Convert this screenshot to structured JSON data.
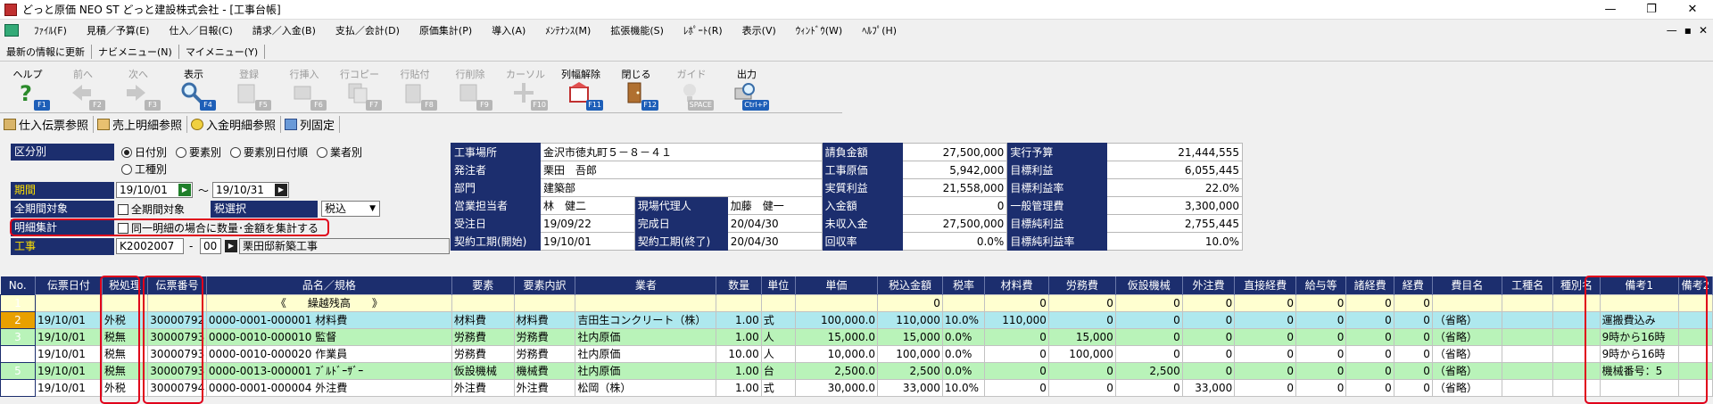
{
  "window": {
    "title": "どっと原価 NEO ST どっと建設株式会社 - [工事台帳]",
    "controls": [
      "—",
      "❐",
      "✕"
    ]
  },
  "menu": [
    "ﾌｧｲﾙ(F)",
    "見積／予算(E)",
    "仕入／日報(C)",
    "請求／入金(B)",
    "支払／会計(D)",
    "原価集計(P)",
    "導入(A)",
    "ﾒﾝﾃﾅﾝｽ(M)",
    "拡張機能(S)",
    "ﾚﾎﾟｰﾄ(R)",
    "表示(V)",
    "ｳｨﾝﾄﾞｳ(W)",
    "ﾍﾙﾌﾟ(H)"
  ],
  "mdi_controls": [
    "—",
    "▪",
    "✕"
  ],
  "bar2": [
    "最新の情報に更新",
    "ナビメニュー(N)",
    "マイメニュー(Y)"
  ],
  "toolbar": [
    {
      "label": "ヘルプ",
      "key": "F1",
      "icon": "question-icon",
      "enabled": true
    },
    {
      "label": "前へ",
      "key": "F2",
      "icon": "arrow-left-icon",
      "enabled": false
    },
    {
      "label": "次へ",
      "key": "F3",
      "icon": "arrow-right-icon",
      "enabled": false
    },
    {
      "label": "表示",
      "key": "F4",
      "icon": "magnifier-icon",
      "enabled": true
    },
    {
      "label": "登録",
      "key": "F5",
      "icon": "register-icon",
      "enabled": false
    },
    {
      "label": "行挿入",
      "key": "F6",
      "icon": "row-insert-icon",
      "enabled": false
    },
    {
      "label": "行コピー",
      "key": "F7",
      "icon": "row-copy-icon",
      "enabled": false
    },
    {
      "label": "行貼付",
      "key": "F8",
      "icon": "row-paste-icon",
      "enabled": false
    },
    {
      "label": "行削除",
      "key": "F9",
      "icon": "row-delete-icon",
      "enabled": false
    },
    {
      "label": "カーソル",
      "key": "F10",
      "icon": "cursor-icon",
      "enabled": false
    },
    {
      "label": "列幅解除",
      "key": "F11",
      "icon": "column-width-icon",
      "enabled": true
    },
    {
      "label": "閉じる",
      "key": "F12",
      "icon": "door-icon",
      "enabled": true
    },
    {
      "label": "ガイド",
      "key": "SPACE",
      "icon": "lightbulb-icon",
      "enabled": false
    },
    {
      "label": "出力",
      "key": "Ctrl+P",
      "icon": "print-magnifier-icon",
      "enabled": true
    }
  ],
  "links": [
    "仕入伝票参照",
    "売上明細参照",
    "入金明細参照",
    "列固定"
  ],
  "filter": {
    "kubun_label": "区分別",
    "kubun_options": [
      "日付別",
      "要素別",
      "要素別日付順",
      "業者別",
      "工種別"
    ],
    "period_label": "期間",
    "period_from": "19/10/01",
    "period_sep": "～",
    "period_to": "19/10/31",
    "allperiod_label": "全期間対象",
    "allperiod_check": "全期間対象",
    "tax_label": "税選択",
    "tax_value": "税込",
    "meisai_label": "明細集計",
    "meisai_check": "同一明細の場合に数量･金額を集計する",
    "kouji_label": "工事",
    "kouji_code": "K2002007",
    "kouji_sep": "-",
    "kouji_sub": "00",
    "kouji_name": "栗田邸新築工事"
  },
  "info": {
    "koji_basho_label": "工事場所",
    "koji_basho": "金沢市徳丸町５－８－４１",
    "hacchusha_label": "発注者",
    "hacchusha": "栗田　吾郎",
    "bumon_label": "部門",
    "bumon": "建築部",
    "eigyo_label": "営業担当者",
    "eigyo": "林　健二",
    "genba_label": "現場代理人",
    "genba": "加藤　健一",
    "juchu_label": "受注日",
    "juchu": "19/09/22",
    "kansei_label": "完成日",
    "kansei": "20/04/30",
    "kaishi_label": "契約工期(開始)",
    "kaishi": "19/10/01",
    "shuryo_label": "契約工期(終了)",
    "shuryo": "20/04/30",
    "m1": [
      [
        "請負金額",
        "27,500,000"
      ],
      [
        "工事原価",
        "5,942,000"
      ],
      [
        "実質利益",
        "21,558,000"
      ],
      [
        "入金額",
        "0"
      ],
      [
        "未収入金",
        "27,500,000"
      ],
      [
        "回収率",
        "0.0%"
      ]
    ],
    "m2": [
      [
        "実行予算",
        "21,444,555"
      ],
      [
        "目標利益",
        "6,055,445"
      ],
      [
        "目標利益率",
        "22.0%"
      ],
      [
        "一般管理費",
        "3,300,000"
      ],
      [
        "目標純利益",
        "2,755,445"
      ],
      [
        "目標純利益率",
        "10.0%"
      ]
    ]
  },
  "grid": {
    "columns": [
      "No.",
      "伝票日付",
      "税処理",
      "伝票番号",
      "品名／規格",
      "要素",
      "要素内訳",
      "業者",
      "数量",
      "単位",
      "単価",
      "税込金額",
      "税率",
      "材料費",
      "労務費",
      "仮設機械",
      "外注費",
      "直接経費",
      "給与等",
      "諸経費",
      "経費",
      "費目名",
      "工種名",
      "種別名",
      "備考1",
      "備考2"
    ],
    "carry": {
      "no": "1",
      "label": "《　　繰越残高　　》",
      "amount": "0",
      "zeros": [
        "0",
        "0",
        "0",
        "0",
        "0",
        "0",
        "0",
        "0"
      ]
    },
    "rows": [
      {
        "no": "2",
        "date": "19/10/01",
        "tax": "外税",
        "slip": "30000792",
        "code": "0000-0001-000001",
        "name": "材料費",
        "elem": "材料費",
        "elem2": "材料費",
        "vendor": "吉田生コンクリート（株）",
        "qty": "1.00",
        "unit": "式",
        "price": "100,000.0",
        "amount": "110,000",
        "rate": "10.0%",
        "c1": "110,000",
        "c2": "0",
        "c3": "0",
        "c4": "0",
        "c5": "0",
        "c6": "0",
        "c7": "0",
        "c8": "0",
        "himoku": "（省略）",
        "biko1": "運搬費込み",
        "style": "b"
      },
      {
        "no": "3",
        "date": "19/10/01",
        "tax": "税無",
        "slip": "30000793",
        "code": "0000-0010-000010",
        "name": "監督",
        "elem": "労務費",
        "elem2": "労務費",
        "vendor": "社内原価",
        "qty": "1.00",
        "unit": "人",
        "price": "15,000.0",
        "amount": "15,000",
        "rate": "0.0%",
        "c1": "0",
        "c2": "15,000",
        "c3": "0",
        "c4": "0",
        "c5": "0",
        "c6": "0",
        "c7": "0",
        "c8": "0",
        "himoku": "（省略）",
        "biko1": "9時から16時",
        "style": "g"
      },
      {
        "no": "4",
        "date": "19/10/01",
        "tax": "税無",
        "slip": "30000793",
        "code": "0000-0010-000020",
        "name": "作業員",
        "elem": "労務費",
        "elem2": "労務費",
        "vendor": "社内原価",
        "qty": "10.00",
        "unit": "人",
        "price": "10,000.0",
        "amount": "100,000",
        "rate": "0.0%",
        "c1": "0",
        "c2": "100,000",
        "c3": "0",
        "c4": "0",
        "c5": "0",
        "c6": "0",
        "c7": "0",
        "c8": "0",
        "himoku": "（省略）",
        "biko1": "9時から16時",
        "style": "w"
      },
      {
        "no": "5",
        "date": "19/10/01",
        "tax": "税無",
        "slip": "30000793",
        "code": "0000-0013-000001",
        "name": "ﾌﾞﾙﾄﾞｰｻﾞｰ",
        "elem": "仮設機械",
        "elem2": "機械費",
        "vendor": "社内原価",
        "qty": "1.00",
        "unit": "台",
        "price": "2,500.0",
        "amount": "2,500",
        "rate": "0.0%",
        "c1": "0",
        "c2": "0",
        "c3": "2,500",
        "c4": "0",
        "c5": "0",
        "c6": "0",
        "c7": "0",
        "c8": "0",
        "himoku": "（省略）",
        "biko1": "機械番号：5",
        "style": "g"
      },
      {
        "no": "6",
        "date": "19/10/01",
        "tax": "外税",
        "slip": "30000794",
        "code": "0000-0001-000004",
        "name": "外注費",
        "elem": "外注費",
        "elem2": "外注費",
        "vendor": "松岡（株）",
        "qty": "1.00",
        "unit": "式",
        "price": "30,000.0",
        "amount": "33,000",
        "rate": "10.0%",
        "c1": "0",
        "c2": "0",
        "c3": "0",
        "c4": "33,000",
        "c5": "0",
        "c6": "0",
        "c7": "0",
        "c8": "0",
        "himoku": "（省略）",
        "biko1": "",
        "style": "w"
      }
    ]
  }
}
